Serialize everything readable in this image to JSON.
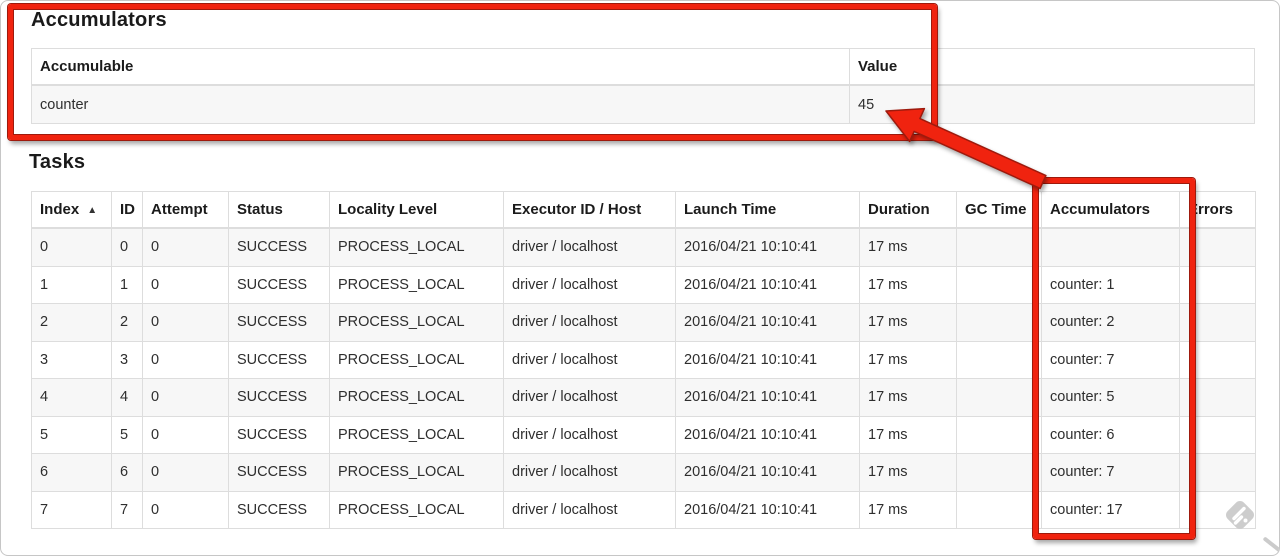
{
  "accumulators": {
    "title": "Accumulators",
    "columns": [
      "Accumulable",
      "Value"
    ],
    "rows": [
      [
        "counter",
        "45"
      ]
    ]
  },
  "tasks": {
    "title": "Tasks",
    "columns": [
      {
        "label": "Index",
        "sort_arrow": "▲"
      },
      {
        "label": "ID"
      },
      {
        "label": "Attempt"
      },
      {
        "label": "Status"
      },
      {
        "label": "Locality Level"
      },
      {
        "label": "Executor ID / Host"
      },
      {
        "label": "Launch Time"
      },
      {
        "label": "Duration"
      },
      {
        "label": "GC Time"
      },
      {
        "label": "Accumulators"
      },
      {
        "label": "Errors"
      }
    ],
    "rows": [
      [
        "0",
        "0",
        "0",
        "SUCCESS",
        "PROCESS_LOCAL",
        "driver / localhost",
        "2016/04/21 10:10:41",
        "17 ms",
        "",
        "",
        ""
      ],
      [
        "1",
        "1",
        "0",
        "SUCCESS",
        "PROCESS_LOCAL",
        "driver / localhost",
        "2016/04/21 10:10:41",
        "17 ms",
        "",
        "counter: 1",
        ""
      ],
      [
        "2",
        "2",
        "0",
        "SUCCESS",
        "PROCESS_LOCAL",
        "driver / localhost",
        "2016/04/21 10:10:41",
        "17 ms",
        "",
        "counter: 2",
        ""
      ],
      [
        "3",
        "3",
        "0",
        "SUCCESS",
        "PROCESS_LOCAL",
        "driver / localhost",
        "2016/04/21 10:10:41",
        "17 ms",
        "",
        "counter: 7",
        ""
      ],
      [
        "4",
        "4",
        "0",
        "SUCCESS",
        "PROCESS_LOCAL",
        "driver / localhost",
        "2016/04/21 10:10:41",
        "17 ms",
        "",
        "counter: 5",
        ""
      ],
      [
        "5",
        "5",
        "0",
        "SUCCESS",
        "PROCESS_LOCAL",
        "driver / localhost",
        "2016/04/21 10:10:41",
        "17 ms",
        "",
        "counter: 6",
        ""
      ],
      [
        "6",
        "6",
        "0",
        "SUCCESS",
        "PROCESS_LOCAL",
        "driver / localhost",
        "2016/04/21 10:10:41",
        "17 ms",
        "",
        "counter: 7",
        ""
      ],
      [
        "7",
        "7",
        "0",
        "SUCCESS",
        "PROCESS_LOCAL",
        "driver / localhost",
        "2016/04/21 10:10:41",
        "17 ms",
        "",
        "counter: 17",
        ""
      ]
    ]
  },
  "annotations": {
    "highlight_color": "#f0230f",
    "outline_color": "#9e1a0d",
    "sort_ascending_icon": "▲",
    "watermark_icon": "skitch-watermark"
  }
}
